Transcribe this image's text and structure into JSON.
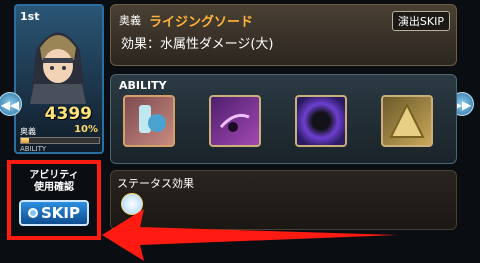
{
  "character": {
    "rank": "1st",
    "hp": "4399",
    "ougi_label": "奥義",
    "charge": "10%",
    "charge_fraction": 0.1,
    "ability_label": "ABILITY"
  },
  "ougi": {
    "tag": "奥義",
    "name": "ライジングソード",
    "effect": "効果：水属性ダメージ(大)",
    "skip_label": "演出SKIP"
  },
  "ability": {
    "title": "ABILITY",
    "icons": [
      "potion-icon",
      "dark-slash-icon",
      "void-orb-icon",
      "golden-wall-icon"
    ]
  },
  "status": {
    "title": "ステータス効果",
    "icon": "shield-buff-icon"
  },
  "confirm": {
    "label_line1": "アビリティ",
    "label_line2": "使用確認",
    "skip_label": "SKIP"
  },
  "colors": {
    "highlight": "#ff1a12",
    "ougi_name": "#ffb33b",
    "skip_button": "#1f6fc0"
  }
}
